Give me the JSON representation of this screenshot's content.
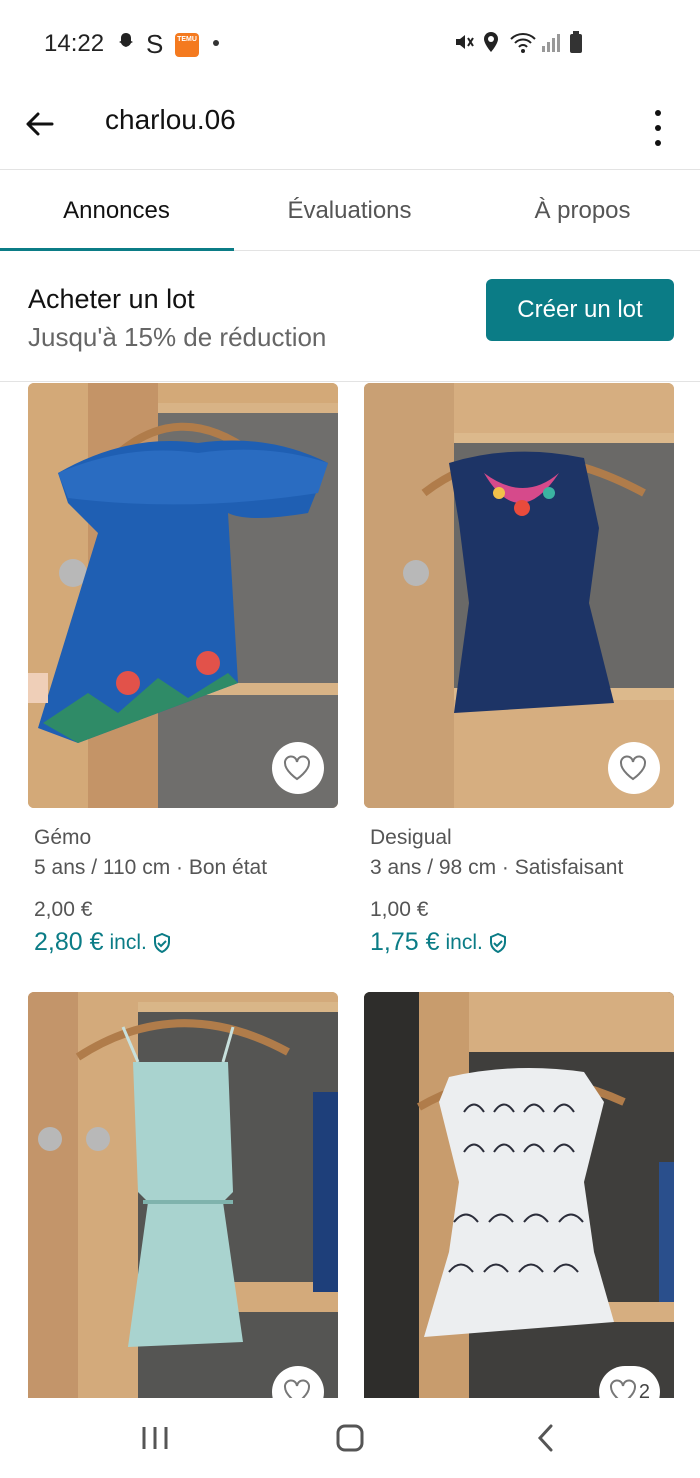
{
  "status_bar": {
    "time": "14:22",
    "icons": [
      "snapchat-icon",
      "s-icon",
      "temu-icon",
      "dot-icon",
      "mute-icon",
      "location-icon",
      "wifi-icon",
      "signal-icon",
      "battery-icon"
    ],
    "temu_label": "TEMU"
  },
  "header": {
    "username": "charlou.06",
    "back_icon": "arrow-left-icon",
    "more_icon": "more-vertical-icon"
  },
  "tabs": [
    {
      "label": "Annonces",
      "active": true
    },
    {
      "label": "Évaluations",
      "active": false
    },
    {
      "label": "À propos",
      "active": false
    }
  ],
  "bundle": {
    "title": "Acheter un lot",
    "subtitle": "Jusqu'à 15% de réduction",
    "button_label": "Créer un lot"
  },
  "items": [
    {
      "brand": "Gémo",
      "size_condition": "5 ans / 110 cm · Bon état",
      "price": "2,00 €",
      "price_incl": "2,80 €",
      "incl_label": "incl.",
      "favorites": ""
    },
    {
      "brand": "Desigual",
      "size_condition": "3 ans / 98 cm · Satisfaisant",
      "price": "1,00 €",
      "price_incl": "1,75 €",
      "incl_label": "incl.",
      "favorites": ""
    },
    {
      "brand": "",
      "size_condition": "",
      "price": "",
      "price_incl": "",
      "incl_label": "",
      "favorites": ""
    },
    {
      "brand": "",
      "size_condition": "",
      "price": "",
      "price_incl": "",
      "incl_label": "",
      "favorites": "2"
    }
  ],
  "colors": {
    "accent": "#0b7c86",
    "text_primary": "#111111",
    "text_secondary": "#555555",
    "divider": "#e3e3e3"
  }
}
